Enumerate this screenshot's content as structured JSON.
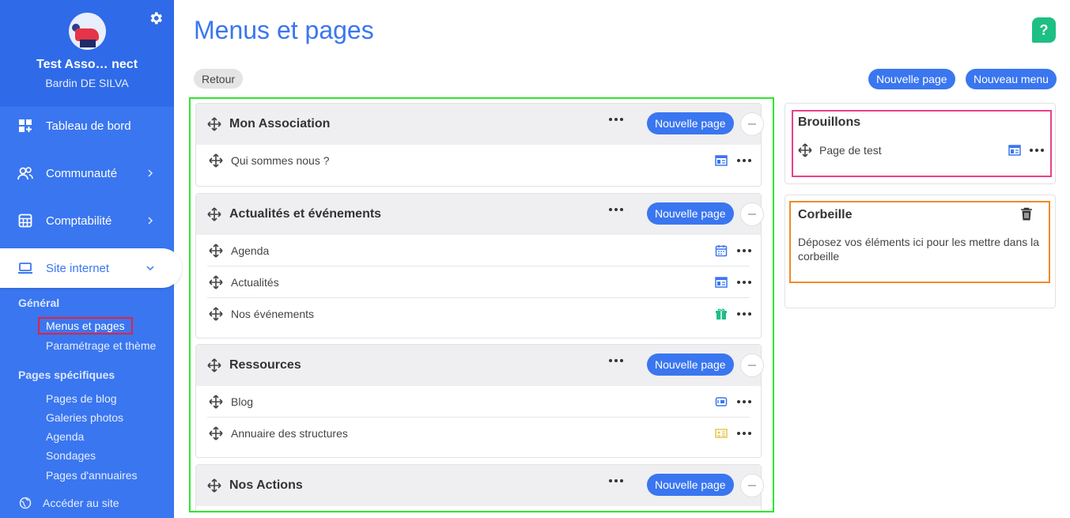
{
  "sidebar": {
    "org_name": "Test Asso… nect",
    "user_name": "Bardin DE SILVA",
    "nav": [
      {
        "label": "Tableau de bord",
        "icon": "dashboard-icon"
      },
      {
        "label": "Communauté",
        "icon": "community-icon"
      },
      {
        "label": "Comptabilité",
        "icon": "calculator-icon"
      },
      {
        "label": "Site internet",
        "icon": "laptop-icon"
      }
    ],
    "section_general": "Général",
    "general_links": [
      "Menus et pages",
      "Paramétrage et thème"
    ],
    "section_specific": "Pages spécifiques",
    "specific_links": [
      "Pages de blog",
      "Galeries photos",
      "Agenda",
      "Sondages",
      "Pages d'annuaires"
    ],
    "bottom_link": "Accéder au site"
  },
  "header": {
    "title": "Menus et pages",
    "help": "?",
    "back": "Retour",
    "new_page": "Nouvelle page",
    "new_menu": "Nouveau menu"
  },
  "menus": [
    {
      "title": "Mon Association",
      "button": "Nouvelle page",
      "pages": [
        {
          "label": "Qui sommes nous ?",
          "type_icon": "page-layout-icon"
        }
      ]
    },
    {
      "title": "Actualités et événements",
      "button": "Nouvelle page",
      "pages": [
        {
          "label": "Agenda",
          "type_icon": "calendar-icon"
        },
        {
          "label": "Actualités",
          "type_icon": "page-layout-icon"
        },
        {
          "label": "Nos événements",
          "type_icon": "gift-icon"
        }
      ]
    },
    {
      "title": "Ressources",
      "button": "Nouvelle page",
      "pages": [
        {
          "label": "Blog",
          "type_icon": "blog-icon"
        },
        {
          "label": "Annuaire des structures",
          "type_icon": "directory-card-icon"
        }
      ]
    },
    {
      "title": "Nos Actions",
      "button": "Nouvelle page",
      "pages": []
    }
  ],
  "drafts": {
    "title": "Brouillons",
    "items": [
      {
        "label": "Page de test",
        "type_icon": "page-layout-icon"
      }
    ]
  },
  "trash": {
    "title": "Corbeille",
    "text": "Déposez vos éléments ici pour les mettre dans la corbeille"
  },
  "colors": {
    "primary": "#3a76f0",
    "help": "#1dbf84",
    "highlight_main": "#2ee62e",
    "highlight_drafts": "#e9408a",
    "highlight_trash": "#f08a2c",
    "highlight_sidebar": "#e5223b"
  }
}
